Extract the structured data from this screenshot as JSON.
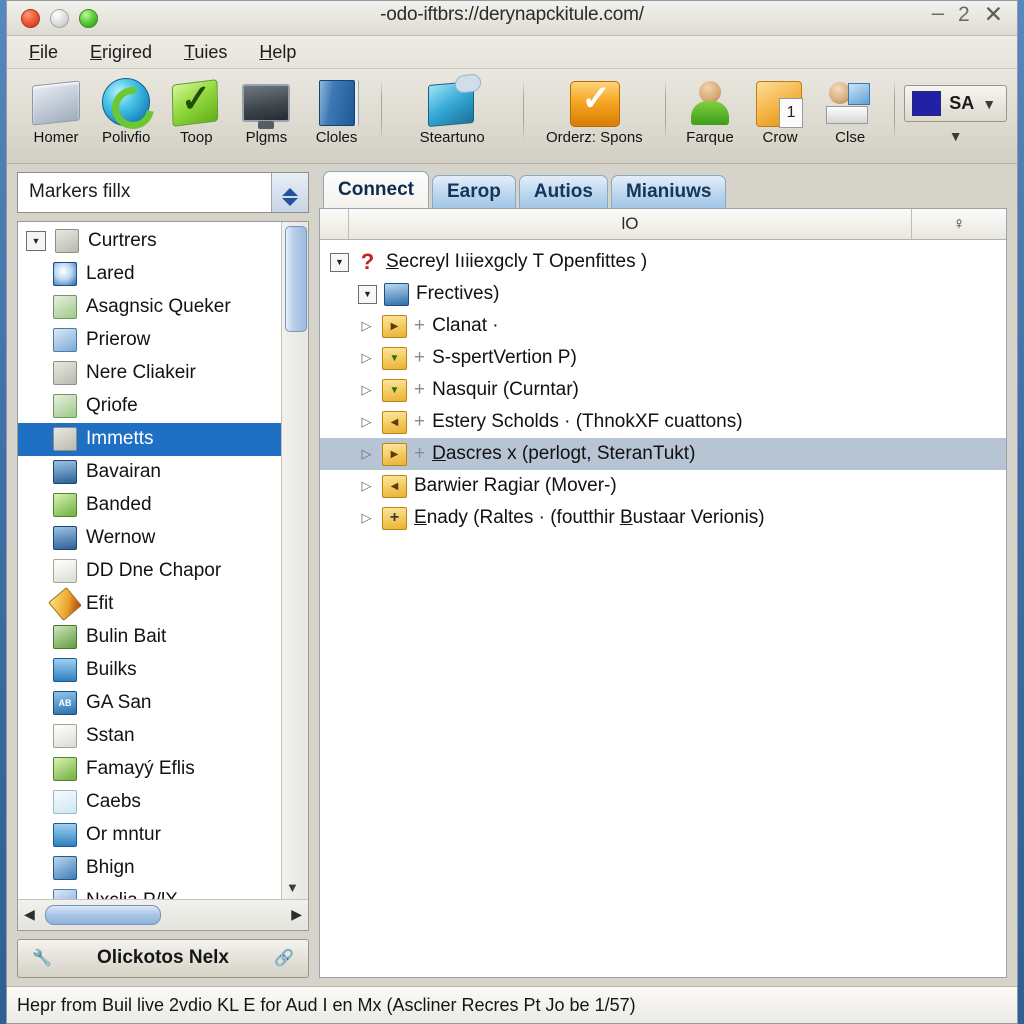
{
  "window": {
    "title": "-odo-iftbrs://derynapckitule.com/",
    "controls": {
      "minimize": "–",
      "restore": "2",
      "close": "✕"
    }
  },
  "menubar": {
    "items": [
      {
        "accel": "F",
        "rest": "ile"
      },
      {
        "accel": "E",
        "rest": "rigired"
      },
      {
        "accel": "T",
        "rest": "uies"
      },
      {
        "accel": "H",
        "rest": "elp"
      }
    ]
  },
  "toolbar": {
    "buttons": [
      {
        "label": "Homer",
        "icon": "folder-grey-icon"
      },
      {
        "label": "Polivfio",
        "icon": "refresh-circle-icon"
      },
      {
        "label": "Toop",
        "icon": "green-check-icon"
      },
      {
        "label": "Plgms",
        "icon": "monitor-icon"
      },
      {
        "label": "Cloles",
        "icon": "blue-book-icon"
      },
      {
        "label": "Steartuno",
        "icon": "cloud-folder-icon"
      },
      {
        "label": "Orderz: Spons",
        "icon": "orange-check-icon"
      },
      {
        "label": "Farque",
        "icon": "person-green-icon"
      },
      {
        "label": "Crow",
        "icon": "note-orange-icon"
      },
      {
        "label": "Clse",
        "icon": "person-card-icon"
      }
    ],
    "color_selector": {
      "label": "SA",
      "swatch": "#2320a8",
      "caret": "▼"
    },
    "overflow": "▼"
  },
  "sidebar": {
    "combo": {
      "value": "Markers fillx",
      "placeholder": "Markers fillx"
    },
    "items": [
      {
        "label": "Curtrers",
        "icon": "card-icon",
        "twisty": "▼",
        "expandable": true
      },
      {
        "label": "Lared",
        "icon": "magnifier-icon"
      },
      {
        "label": "Asagnsic Queker",
        "icon": "green-doc-icon"
      },
      {
        "label": "Prierow",
        "icon": "blue-search-icon"
      },
      {
        "label": "Nere Cliakeir",
        "icon": "card-icon"
      },
      {
        "label": "Qriofe",
        "icon": "green-doc-icon"
      },
      {
        "label": "Immetts",
        "icon": "card-icon",
        "selected": true
      },
      {
        "label": "Bavairan",
        "icon": "dark-blue-icon"
      },
      {
        "label": "Banded",
        "icon": "star-green-icon"
      },
      {
        "label": "Wernow",
        "icon": "dark-blue-icon"
      },
      {
        "label": "DD Dne Chapor",
        "icon": "paper-icon"
      },
      {
        "label": "Efit",
        "icon": "pencil-icon"
      },
      {
        "label": "Bulin Bait",
        "icon": "tools-icon"
      },
      {
        "label": "Builks",
        "icon": "screen-icon"
      },
      {
        "label": "GA San",
        "icon": "ab-icon"
      },
      {
        "label": "Sstan",
        "icon": "paper-icon"
      },
      {
        "label": "Famayý Eflis",
        "icon": "star-green-icon"
      },
      {
        "label": "Caebs",
        "icon": "folder-icon"
      },
      {
        "label": "Or mntur",
        "icon": "screen-icon"
      },
      {
        "label": "Bhign",
        "icon": "film-icon"
      },
      {
        "label": "Nxclia P/lX",
        "icon": "blue-search-icon"
      }
    ],
    "vscroll": {
      "down_arrow": "▼"
    },
    "hscroll": {
      "left_arrow": "◀",
      "right_arrow": "▶"
    },
    "bottom_button": {
      "label": "Olickotos Nelx",
      "left_icon": "wrench-icon",
      "right_icon": "link-icon"
    }
  },
  "main": {
    "tabs": [
      {
        "label": "Connect",
        "active": true
      },
      {
        "label": "Earop",
        "active": false
      },
      {
        "label": "Autios",
        "active": false
      },
      {
        "label": "Mianiuws",
        "active": false
      }
    ],
    "tree_header": {
      "col1": "",
      "col2": "lO",
      "col3": "♀"
    },
    "tree": [
      {
        "indent": 0,
        "toggle": "▼",
        "icon": "question-mark-icon",
        "plus": false,
        "accel": "S",
        "rest": "ecreyl Iıiiexgcly T Openfittes )"
      },
      {
        "indent": 1,
        "toggle": "▼",
        "icon": "db-blue-icon",
        "plus": false,
        "accel": "",
        "rest": "Frectives)"
      },
      {
        "indent": 2,
        "toggle": "▷",
        "icon": "yellow-play-icon",
        "plus": true,
        "accel": "",
        "rest": "Clanat  ·"
      },
      {
        "indent": 2,
        "toggle": "▷",
        "icon": "yellow-down-icon",
        "plus": true,
        "accel": "",
        "rest": "S-spertVertion P)"
      },
      {
        "indent": 2,
        "toggle": "▷",
        "icon": "yellow-down-icon",
        "plus": true,
        "accel": "",
        "rest": "Nasquir (Curntar)"
      },
      {
        "indent": 2,
        "toggle": "▷",
        "icon": "yellow-left-icon",
        "plus": true,
        "accel": "",
        "rest": "Estery Scholds  ·  (ThnokXF cuattons)"
      },
      {
        "indent": 2,
        "toggle": "▷",
        "icon": "yellow-right-icon",
        "plus": true,
        "accel": "D",
        "rest": "ascres x (perlogt, SteranTukt)",
        "selected": true
      },
      {
        "indent": 2,
        "toggle": "▷",
        "icon": "yellow-left-icon",
        "plus": false,
        "accel": "",
        "rest": "Barwier Ragiar (Mover-)"
      },
      {
        "indent": 2,
        "toggle": "▷",
        "icon": "yellow-plus-icon",
        "plus": false,
        "accel": "E",
        "rest": "nady (Raltes ·  (foutthir ",
        "accel2": "B",
        "rest2": "ustaar Verionis)"
      }
    ]
  },
  "statusbar": {
    "text": "Hepr from Buil live 2vdio KL E for Aud I en Mx (Ascliner Recres Pt Jo be 1/57)"
  }
}
